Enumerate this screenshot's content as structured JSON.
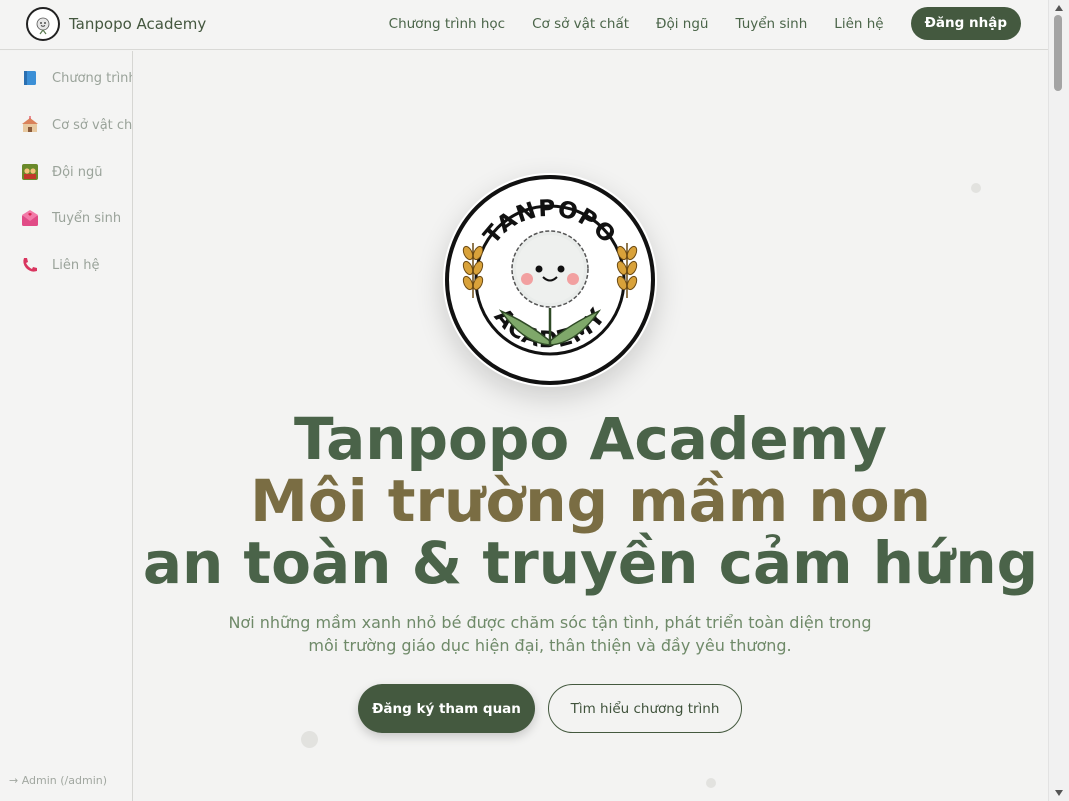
{
  "brand": {
    "name": "Tanpopo Academy",
    "logo_top": "TANPOPO",
    "logo_bottom": "ACADEMY"
  },
  "nav": {
    "links": [
      "Chương trình học",
      "Cơ sở vật chất",
      "Đội ngũ",
      "Tuyển sinh",
      "Liên hệ"
    ],
    "login": "Đăng nhập"
  },
  "sidebar": {
    "items": [
      {
        "label": "Chương trình học",
        "icon": "book-icon"
      },
      {
        "label": "Cơ sở vật chất",
        "icon": "school-icon"
      },
      {
        "label": "Đội ngũ",
        "icon": "team-icon"
      },
      {
        "label": "Tuyển sinh",
        "icon": "mail-icon"
      },
      {
        "label": "Liên hệ",
        "icon": "phone-icon"
      }
    ],
    "admin_link": "→ Admin (/admin)"
  },
  "hero": {
    "line1": "Tanpopo Academy",
    "line2": "Môi trường mầm non",
    "line3": "an toàn & truyền cảm hứng",
    "subtitle_line1": "Nơi những mầm xanh nhỏ bé được chăm sóc tận tình, phát triển toàn diện trong",
    "subtitle_line2": "môi trường giáo dục hiện đại, thân thiện và đầy yêu thương.",
    "primary_button": "Đăng ký tham quan",
    "secondary_button": "Tìm hiểu chương trình"
  },
  "colors": {
    "primary": "#44593f",
    "accent": "#7a6d43",
    "background": "#f3f3f2"
  }
}
